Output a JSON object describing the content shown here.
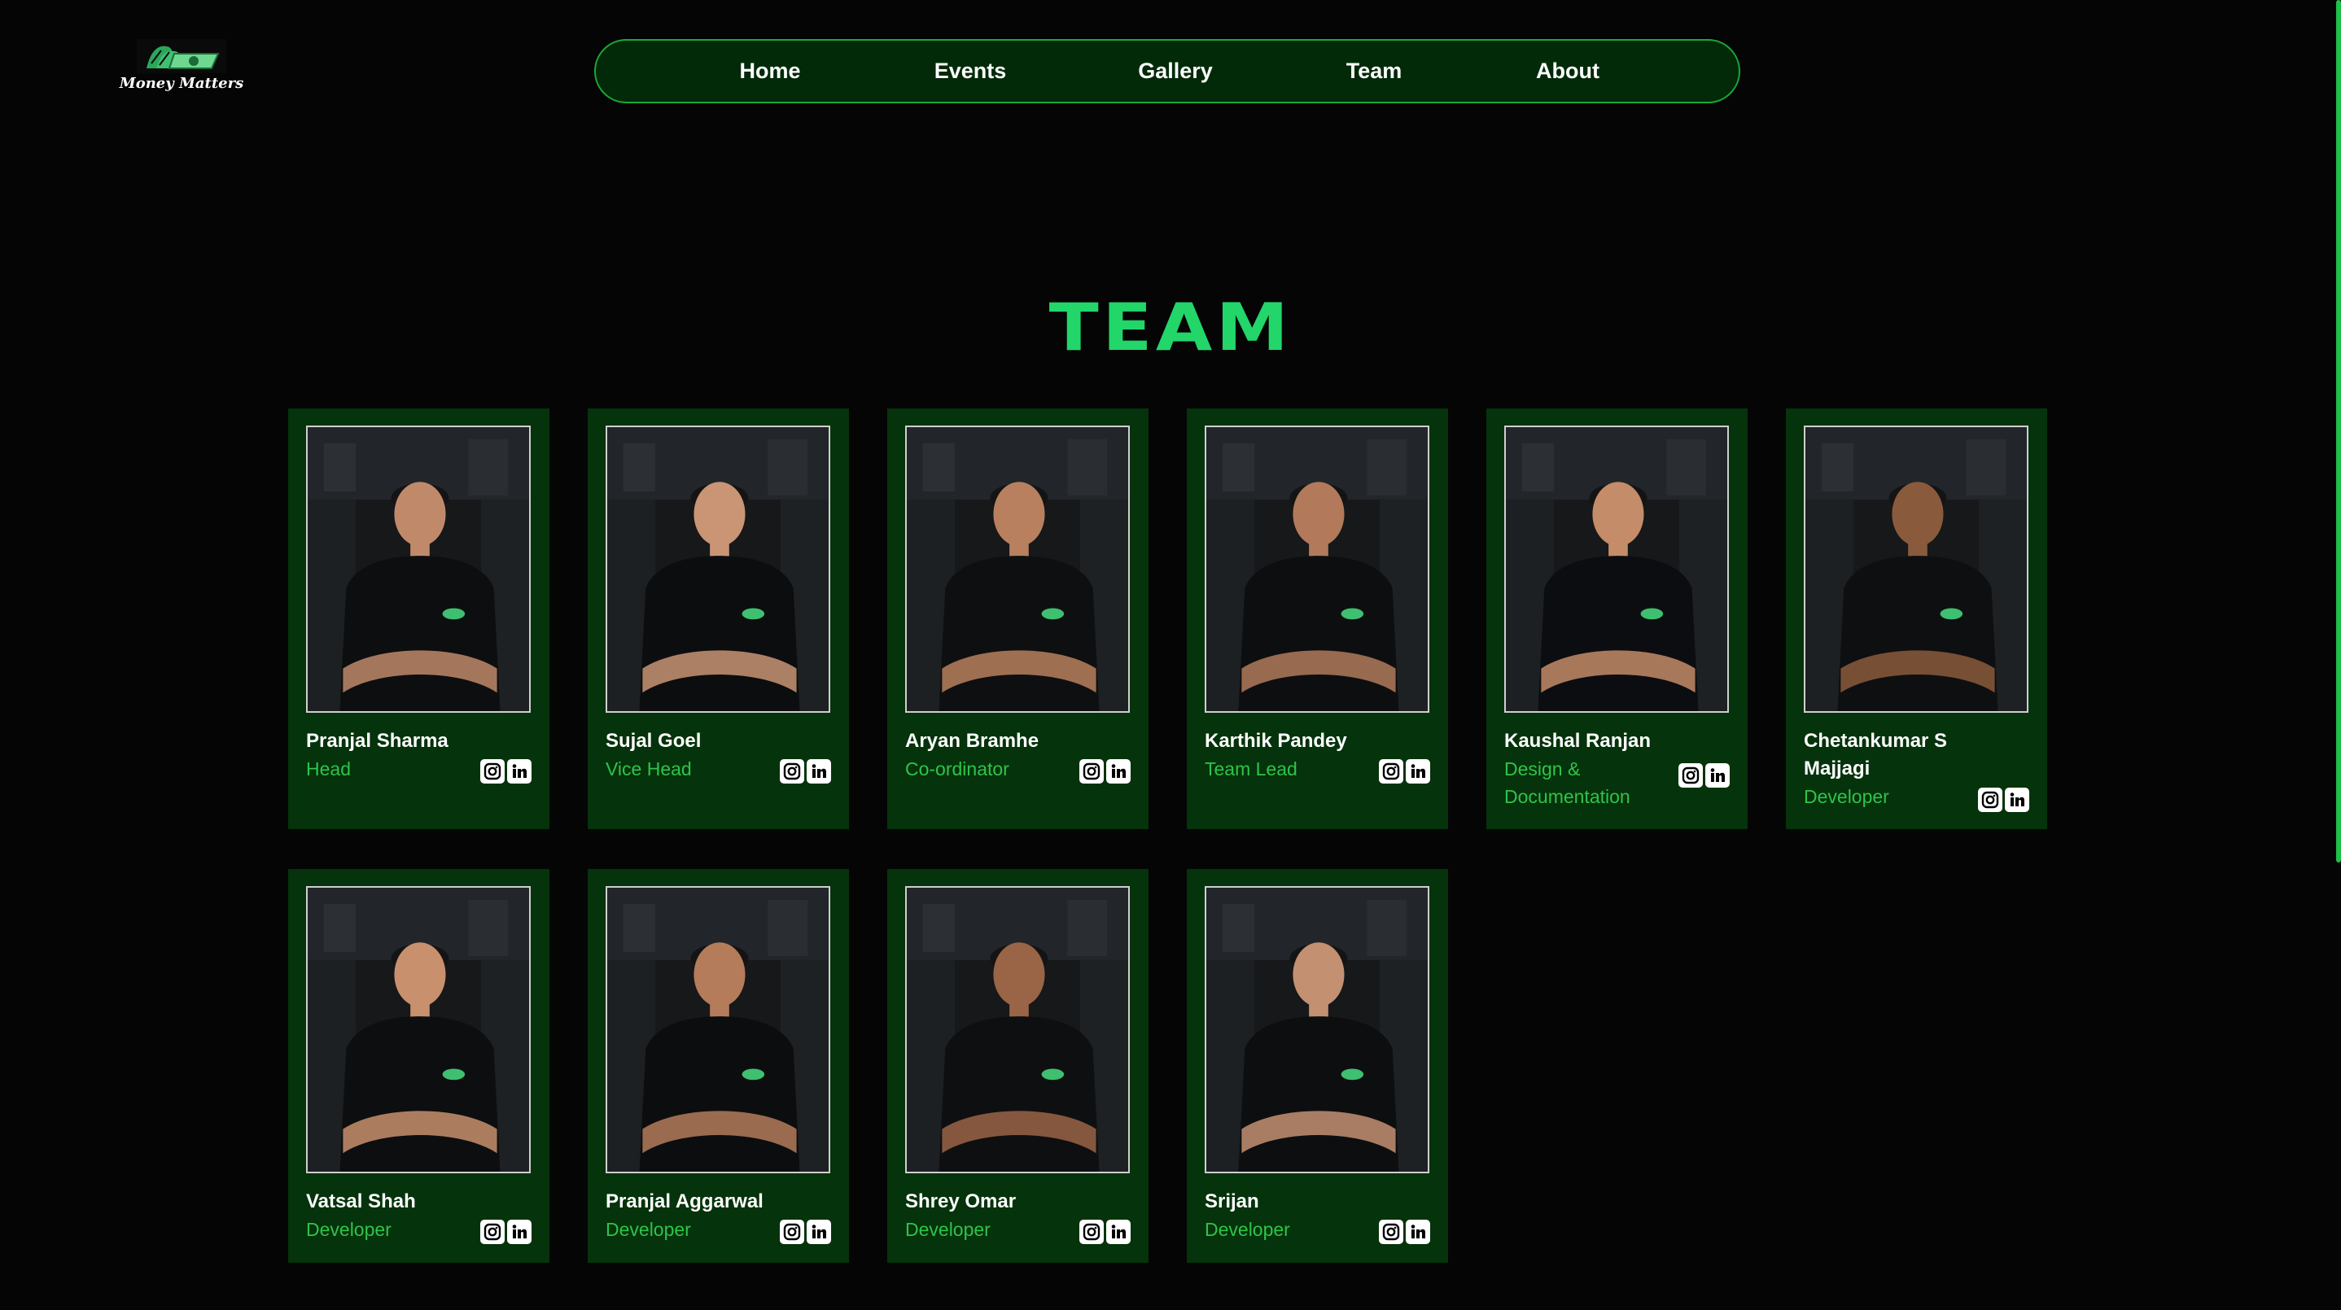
{
  "brand": {
    "logo_text": "Money Matters",
    "accent": "#22d66a",
    "card_bg": "#05330b"
  },
  "nav": {
    "items": [
      {
        "label": "Home"
      },
      {
        "label": "Events"
      },
      {
        "label": "Gallery"
      },
      {
        "label": "Team"
      },
      {
        "label": "About"
      }
    ]
  },
  "page_title": "TEAM",
  "members": [
    {
      "name": "Pranjal Sharma",
      "role": "Head"
    },
    {
      "name": "Sujal Goel",
      "role": "Vice Head"
    },
    {
      "name": "Aryan Bramhe",
      "role": "Co-ordinator"
    },
    {
      "name": "Karthik Pandey",
      "role": "Team Lead"
    },
    {
      "name": "Kaushal Ranjan",
      "role": "Design & Documentation"
    },
    {
      "name": "Chetankumar S Majjagi",
      "role": "Developer"
    },
    {
      "name": "Vatsal Shah",
      "role": "Developer"
    },
    {
      "name": "Pranjal Aggarwal",
      "role": "Developer"
    },
    {
      "name": "Shrey Omar",
      "role": "Developer"
    },
    {
      "name": "Srijan",
      "role": "Developer"
    }
  ],
  "icons": {
    "instagram": "instagram-icon",
    "linkedin": "linkedin-icon"
  }
}
